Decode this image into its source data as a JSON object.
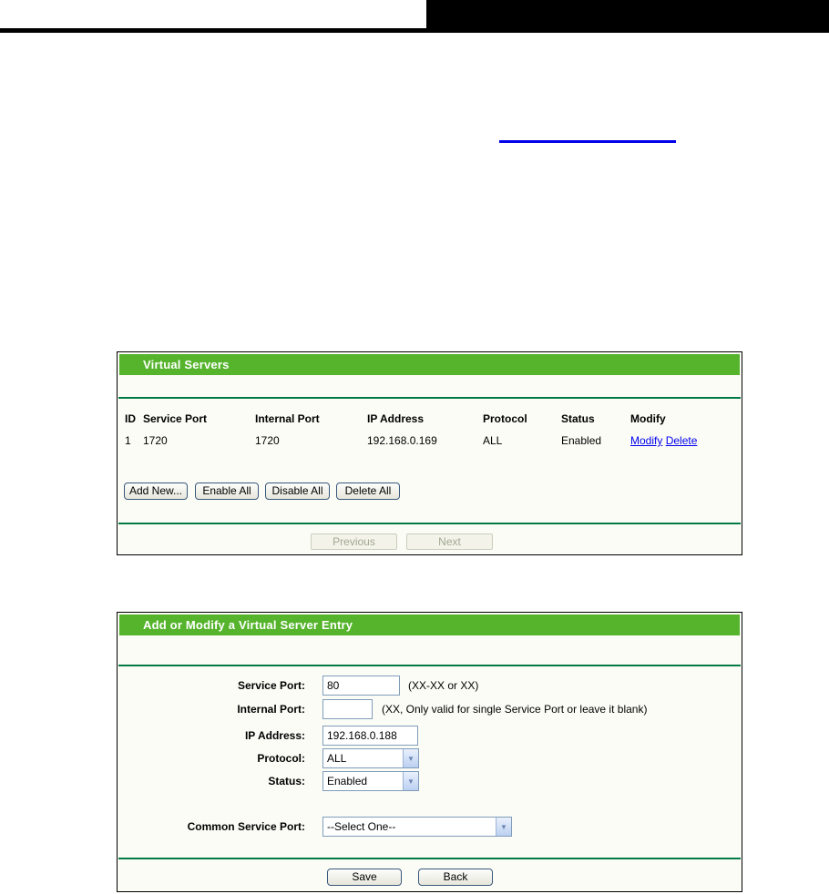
{
  "panel1": {
    "title": "Virtual Servers",
    "table": {
      "columns": [
        "ID",
        "Service Port",
        "Internal Port",
        "IP Address",
        "Protocol",
        "Status",
        "Modify"
      ],
      "rows": [
        {
          "id": "1",
          "service_port": "1720",
          "internal_port": "1720",
          "ip_address": "192.168.0.169",
          "protocol": "ALL",
          "status": "Enabled",
          "modify_link": "Modify",
          "delete_link": "Delete"
        }
      ]
    },
    "buttons": {
      "add_new": "Add New...",
      "enable_all": "Enable All",
      "disable_all": "Disable All",
      "delete_all": "Delete All"
    },
    "pager": {
      "previous": "Previous",
      "next": "Next"
    }
  },
  "panel2": {
    "title": "Add or Modify a Virtual Server Entry",
    "fields": {
      "service_port": {
        "label": "Service Port:",
        "value": "80",
        "hint": "(XX-XX or XX)"
      },
      "internal_port": {
        "label": "Internal Port:",
        "value": "",
        "hint": "(XX, Only valid for single Service Port or leave it blank)"
      },
      "ip_address": {
        "label": "IP Address:",
        "value": "192.168.0.188"
      },
      "protocol": {
        "label": "Protocol:",
        "value": "ALL"
      },
      "status": {
        "label": "Status:",
        "value": "Enabled"
      },
      "common_service_port": {
        "label": "Common Service Port:",
        "value": "--Select One--"
      }
    },
    "buttons": {
      "save": "Save",
      "back": "Back"
    }
  },
  "icons": {
    "dropdown_arrow": "▼"
  },
  "colors": {
    "panel_header_green": "#55b42c",
    "divider_green": "#007a45",
    "link_blue": "#0000ee",
    "input_border_blue": "#7f9db9",
    "button_border_navy": "#39587a",
    "disabled_text": "#a2a892",
    "header_black": "#000000"
  }
}
